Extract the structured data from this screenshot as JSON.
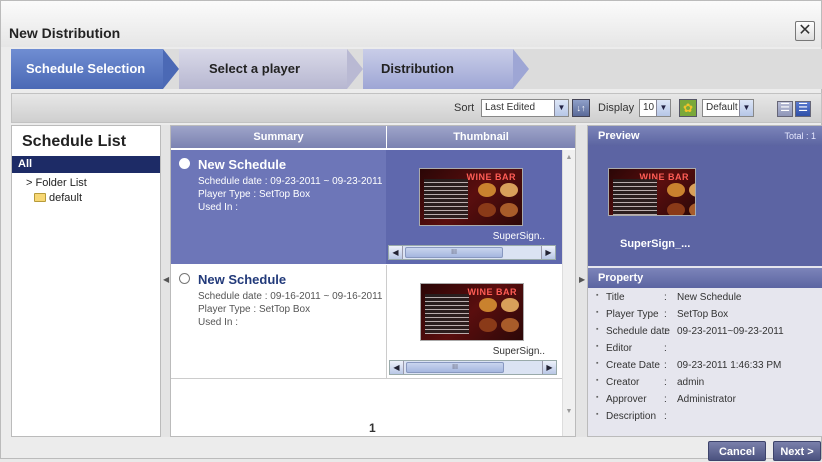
{
  "dialog": {
    "title": "New Distribution",
    "close_glyph": "✕"
  },
  "steps": [
    "Schedule Selection",
    "Select a player",
    "Distribution"
  ],
  "toolbar": {
    "sort_label": "Sort",
    "sort_value": "Last Edited",
    "sort_order_glyph": "↓↑",
    "display_label": "Display",
    "display_count": "10",
    "display_mode": "Default"
  },
  "schedule_list": {
    "title": "Schedule List",
    "all": "All",
    "folder_list": "> Folder List",
    "folders": [
      "default"
    ]
  },
  "table": {
    "col_summary": "Summary",
    "col_thumbnail": "Thumbnail",
    "rows": [
      {
        "name": "New Schedule",
        "schedule_date": "Schedule date : 09-23-2011 ~ 09-23-2011",
        "player_type": "Player Type : SetTop Box",
        "used_in": "Used In :",
        "thumb_title": "WINE BAR",
        "thumb_name": "SuperSign..",
        "selected": true
      },
      {
        "name": "New Schedule",
        "schedule_date": "Schedule date : 09-16-2011 ~ 09-16-2011",
        "player_type": "Player Type : SetTop Box",
        "used_in": "Used In :",
        "thumb_title": "WINE BAR",
        "thumb_name": "SuperSign..",
        "selected": false
      }
    ],
    "page": "1",
    "scroll_glyph": "III"
  },
  "preview": {
    "title": "Preview",
    "total": "Total : 1",
    "thumb_title": "WINE BAR",
    "name": "SuperSign_..."
  },
  "property": {
    "title": "Property",
    "rows": [
      {
        "label": "Title",
        "value": "New Schedule"
      },
      {
        "label": "Player Type",
        "value": "SetTop Box"
      },
      {
        "label": "Schedule date",
        "value": "09-23-2011~09-23-2011"
      },
      {
        "label": "Editor",
        "value": ""
      },
      {
        "label": "Create Date",
        "value": "09-23-2011 1:46:33 PM"
      },
      {
        "label": "Creator",
        "value": "admin"
      },
      {
        "label": "Approver",
        "value": "Administrator"
      },
      {
        "label": "Description",
        "value": ""
      }
    ]
  },
  "buttons": {
    "cancel": "Cancel",
    "next": "Next >"
  },
  "colors": {
    "accent": "#4b69b5",
    "selected_row": "#6d76b8",
    "nav_dark": "#1d2b66"
  }
}
